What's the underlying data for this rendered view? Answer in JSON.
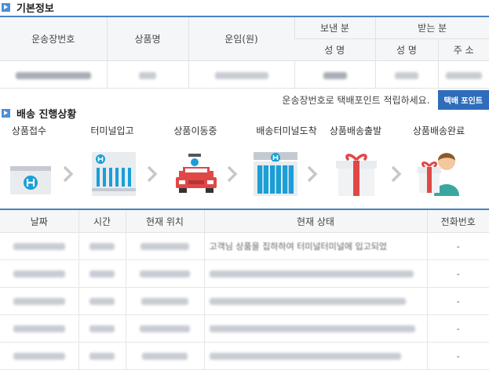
{
  "basic_info": {
    "title": "기본정보",
    "headers": {
      "waybill": "운송장번호",
      "product": "상품명",
      "fare": "운임(원)",
      "sender": "보낸 분",
      "receiver": "받는 분",
      "sender_name": "성 명",
      "receiver_name": "성 명",
      "receiver_address": "주 소"
    }
  },
  "points": {
    "message": "운송장번호로 택배포인트 적립하세요.",
    "button": "택배 포인트"
  },
  "progress": {
    "title": "배송 진행상황",
    "steps": [
      "상품접수",
      "터미널입고",
      "상품이동중",
      "배송터미널도착",
      "상품배송출발",
      "상품배송완료"
    ]
  },
  "tracking": {
    "headers": {
      "date": "날짜",
      "time": "시간",
      "location": "현재 위치",
      "status": "현재 상태",
      "phone": "전화번호"
    },
    "first_status": "고객님 상품을 집하하여 터미널터미널에 입고되었",
    "phone_values": [
      "-",
      "-",
      "-",
      "-",
      "-"
    ]
  },
  "colors": {
    "accent": "#4a82c3",
    "button": "#2f6dbb",
    "icon_blue": "#1a9fd6",
    "icon_red": "#e04848"
  }
}
